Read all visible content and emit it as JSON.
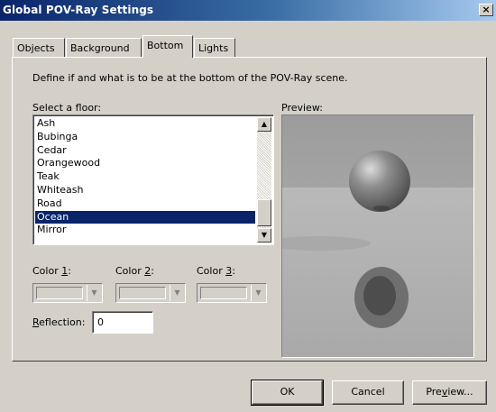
{
  "window": {
    "title": "Global POV-Ray Settings",
    "close_glyph": "×"
  },
  "tabs": [
    {
      "label": "Objects"
    },
    {
      "label": "Background"
    },
    {
      "label": "Bottom"
    },
    {
      "label": "Lights"
    }
  ],
  "active_tab": "Bottom",
  "description": "Define if and what is to be at the bottom of the POV-Ray scene.",
  "floor": {
    "label": "Select a floor:",
    "items": [
      "Ash",
      "Bubinga",
      "Cedar",
      "Orangewood",
      "Teak",
      "Whiteash",
      "Road",
      "Ocean",
      "Mirror"
    ],
    "selected": "Ocean"
  },
  "preview": {
    "label": "Preview:"
  },
  "colors": [
    {
      "label_prefix": "Color ",
      "label_key": "1",
      "label_suffix": ":"
    },
    {
      "label_prefix": "Color ",
      "label_key": "2",
      "label_suffix": ":"
    },
    {
      "label_prefix": "Color ",
      "label_key": "3",
      "label_suffix": ":"
    }
  ],
  "reflection": {
    "label_key": "R",
    "label_rest": "eflection:",
    "value": "0"
  },
  "buttons": {
    "ok": "OK",
    "cancel": "Cancel",
    "preview_a": "Pre",
    "preview_key": "v",
    "preview_b": "iew..."
  },
  "icons": {
    "scroll_up": "up-arrow-icon",
    "scroll_down": "down-arrow-icon",
    "dropdown": "dropdown-arrow-icon"
  }
}
